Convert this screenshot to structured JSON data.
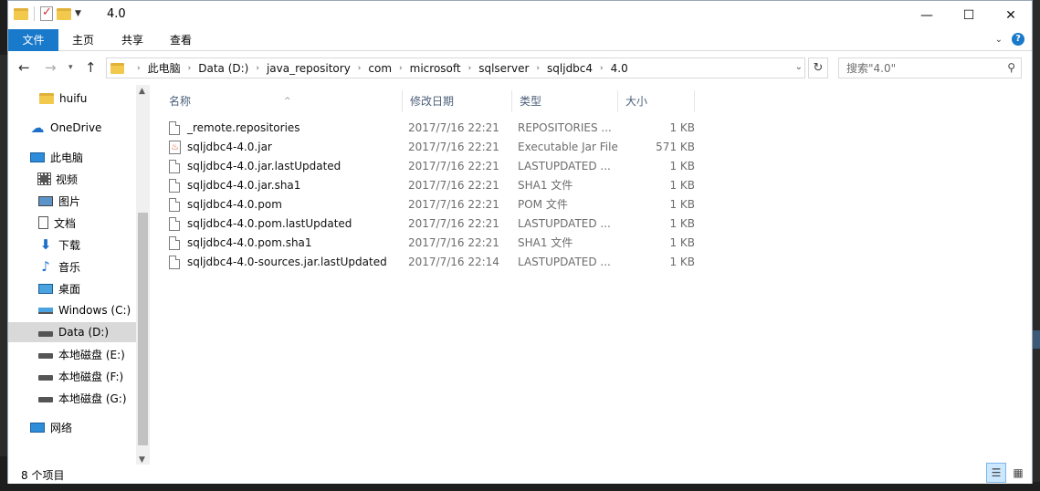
{
  "window": {
    "title": "4.0",
    "controls": {
      "minimize": "—",
      "maximize": "☐",
      "close": "✕"
    }
  },
  "ribbon": {
    "tabs": [
      {
        "label": "文件"
      },
      {
        "label": "主页"
      },
      {
        "label": "共享"
      },
      {
        "label": "查看"
      }
    ]
  },
  "address": {
    "crumbs": [
      "此电脑",
      "Data (D:)",
      "java_repository",
      "com",
      "microsoft",
      "sqlserver",
      "sqljdbc4",
      "4.0"
    ]
  },
  "search": {
    "placeholder": "搜索\"4.0\""
  },
  "sidebar": {
    "items": [
      {
        "label": "huifu",
        "icon": "folder-icon"
      },
      {
        "label": "OneDrive",
        "icon": "cloud-icon"
      },
      {
        "label": "此电脑",
        "icon": "computer-icon"
      },
      {
        "label": "视频",
        "icon": "video-icon"
      },
      {
        "label": "图片",
        "icon": "picture-icon"
      },
      {
        "label": "文档",
        "icon": "document-icon"
      },
      {
        "label": "下载",
        "icon": "download-icon"
      },
      {
        "label": "音乐",
        "icon": "music-icon"
      },
      {
        "label": "桌面",
        "icon": "desktop-icon"
      },
      {
        "label": "Windows (C:)",
        "icon": "windows-drive-icon"
      },
      {
        "label": "Data (D:)",
        "icon": "drive-icon"
      },
      {
        "label": "本地磁盘 (E:)",
        "icon": "drive-icon"
      },
      {
        "label": "本地磁盘 (F:)",
        "icon": "drive-icon"
      },
      {
        "label": "本地磁盘 (G:)",
        "icon": "drive-icon"
      },
      {
        "label": "网络",
        "icon": "network-icon"
      }
    ]
  },
  "columns": {
    "name": "名称",
    "date": "修改日期",
    "type": "类型",
    "size": "大小"
  },
  "files": [
    {
      "name": "_remote.repositories",
      "date": "2017/7/16 22:21",
      "type": "REPOSITORIES ...",
      "size": "1 KB",
      "icon": "file-icon"
    },
    {
      "name": "sqljdbc4-4.0.jar",
      "date": "2017/7/16 22:21",
      "type": "Executable Jar File",
      "size": "571 KB",
      "icon": "jar-icon"
    },
    {
      "name": "sqljdbc4-4.0.jar.lastUpdated",
      "date": "2017/7/16 22:21",
      "type": "LASTUPDATED ...",
      "size": "1 KB",
      "icon": "file-icon"
    },
    {
      "name": "sqljdbc4-4.0.jar.sha1",
      "date": "2017/7/16 22:21",
      "type": "SHA1 文件",
      "size": "1 KB",
      "icon": "file-icon"
    },
    {
      "name": "sqljdbc4-4.0.pom",
      "date": "2017/7/16 22:21",
      "type": "POM 文件",
      "size": "1 KB",
      "icon": "file-icon"
    },
    {
      "name": "sqljdbc4-4.0.pom.lastUpdated",
      "date": "2017/7/16 22:21",
      "type": "LASTUPDATED ...",
      "size": "1 KB",
      "icon": "file-icon"
    },
    {
      "name": "sqljdbc4-4.0.pom.sha1",
      "date": "2017/7/16 22:21",
      "type": "SHA1 文件",
      "size": "1 KB",
      "icon": "file-icon"
    },
    {
      "name": "sqljdbc4-4.0-sources.jar.lastUpdated",
      "date": "2017/7/16 22:14",
      "type": "LASTUPDATED ...",
      "size": "1 KB",
      "icon": "file-icon"
    }
  ],
  "status": {
    "item_count": "8 个项目"
  }
}
